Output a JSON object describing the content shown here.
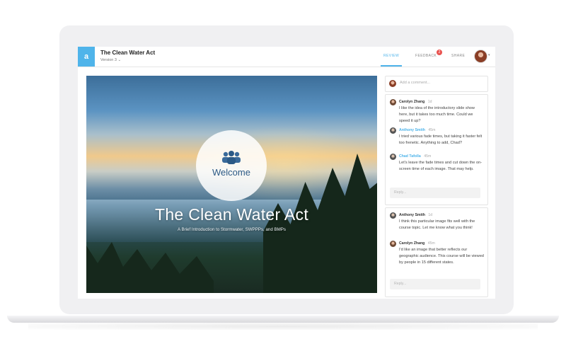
{
  "app": {
    "logo": "a",
    "title": "The Clean Water Act",
    "version": "Version 3 ⌄"
  },
  "nav": {
    "review": "REVIEW",
    "feedback": "FEEDBACK",
    "feedback_count": "2",
    "share": "SHARE",
    "caret": "▾"
  },
  "slide": {
    "welcome": "Welcome",
    "title": "The Clean Water Act",
    "subtitle": "A Brief Introduction to Stormwater, SWPPPs, and BMPs",
    "icon": "people-group-icon"
  },
  "comments": {
    "placeholder": "Add a comment...",
    "reply_placeholder": "Reply...",
    "threads": [
      {
        "items": [
          {
            "name": "Carolyn Zhang",
            "time": "1d",
            "text": "I like the idea of the introductory slide show here, but it takes too much time. Could we speed it up?"
          },
          {
            "name": "Anthony Smith",
            "time": "45m",
            "text": "I tried various fade times, but taking it faster felt too frenetic. Anything to add, Chad?"
          },
          {
            "name": "Chad Tafolla",
            "time": "45m",
            "text": "Let's leave the fade times and cut down the on-screen time of each image. That may help."
          }
        ]
      },
      {
        "items": [
          {
            "name": "Anthony Smith",
            "time": "1d",
            "text": "I think this particular image fits well with the course topic. Let me know what you think!"
          },
          {
            "name": "Carolyn Zhang",
            "time": "45m",
            "text": "I'd like an image that better reflects our geographic audience. This course will be viewed by people in 15 different states."
          }
        ]
      }
    ]
  },
  "colors": {
    "accent": "#4fb4ea",
    "badge": "#e9534f"
  }
}
